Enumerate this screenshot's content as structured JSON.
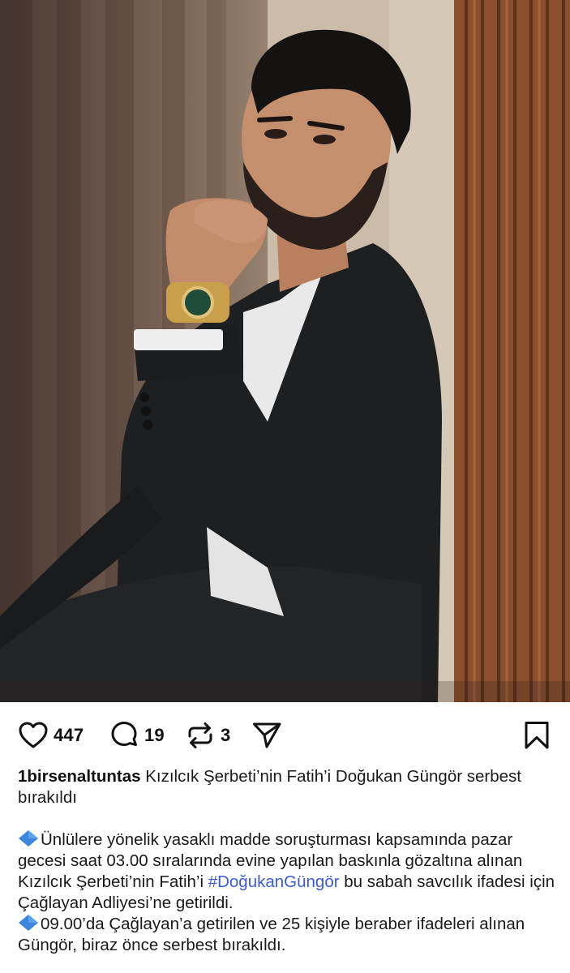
{
  "post": {
    "image_alt": "Man in black suit with gold watch, hand on chin",
    "likes": "447",
    "comments": "19",
    "reposts": "3"
  },
  "icons": {
    "like": "heart-icon",
    "comment": "comment-bubble-icon",
    "repost": "repost-icon",
    "share": "send-icon",
    "save": "bookmark-icon",
    "bullet": "blue-diamond-icon"
  },
  "caption": {
    "username": "1birsenaltuntas",
    "headline": " Kızılcık Şerbeti’nin Fatih’i Doğukan Güngör serbest bırakıldı",
    "para1_text": "Ünlülere yönelik yasaklı madde soruşturması kapsamında pazar gecesi saat 03.00 sıralarında evine yapılan baskınla gözaltına alınan Kızılcık Şerbeti’nin Fatih’i ",
    "para1_hashtag": "#DoğukanGüngör",
    "para1_tail": " bu sabah savcılık ifadesi için Çağlayan Adliyesi’ne getirildi.",
    "para2_text": "09.00’da Çağlayan’a getirilen ve 25 kişiyle beraber ifadeleri alınan Güngör, biraz önce serbest bırakıldı."
  },
  "colors": {
    "hashtag": "#3b5bd6",
    "bullet": "#3a86e0",
    "text": "#1a1a1a"
  }
}
